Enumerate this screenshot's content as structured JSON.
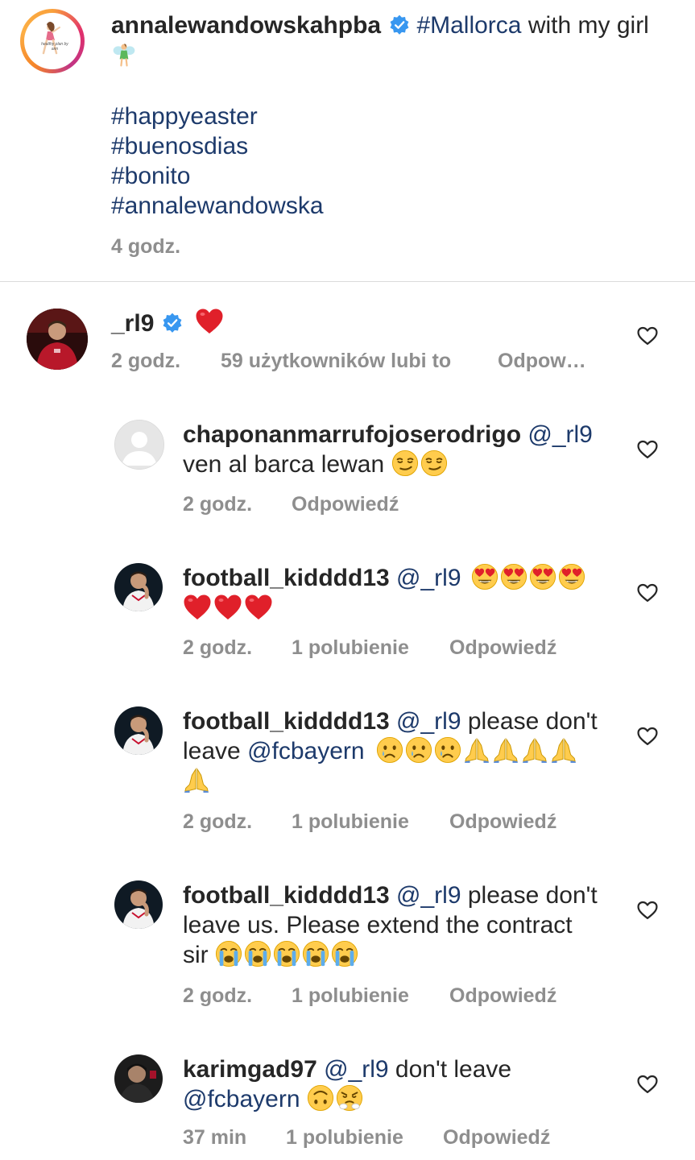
{
  "post": {
    "username": "annalewandowskahpba",
    "caption_tag": "#Mallorca",
    "caption_text": " with my girl",
    "hashtags": [
      "#happyeaster",
      "#buenosdias",
      "#bonito",
      "#annalewandowska"
    ],
    "time": "4 godz.",
    "avatar_text": "healthy plan by ann"
  },
  "comments": [
    {
      "username": "_rl9",
      "verified": true,
      "time": "2 godz.",
      "likes": "59 użytkowników lubi to",
      "reply": "Odpow…"
    },
    {
      "username": "chaponanmarrufojoserodrigo",
      "mention": "@_rl9",
      "line2": "ven al barca lewan ",
      "time": "2 godz.",
      "reply": "Odpowiedź"
    },
    {
      "username": "football_kidddd13",
      "mention": "@_rl9",
      "time": "2 godz.",
      "likes": "1 polubienie",
      "reply": "Odpowiedź"
    },
    {
      "username": "football_kidddd13",
      "mention": "@_rl9",
      "text1": " please don't",
      "text2": "leave ",
      "mention2": "@fcbayern",
      "time": "2 godz.",
      "likes": "1 polubienie",
      "reply": "Odpowiedź"
    },
    {
      "username": "football_kidddd13",
      "mention": "@_rl9",
      "text1": " please don't",
      "text2": "leave us. Please extend the contract",
      "text3": "sir ",
      "time": "2 godz.",
      "likes": "1 polubienie",
      "reply": "Odpowiedź"
    },
    {
      "username": "karimgad97",
      "mention": "@_rl9",
      "text1": " don't leave",
      "mention2": "@fcbayern",
      "time": "37 min",
      "likes": "1 polubienie",
      "reply": "Odpowiedź"
    }
  ],
  "colors": {
    "mention": "#1d3a6b",
    "meta": "#8e8e8e",
    "verified": "#3897f0",
    "heart": "#ed4956"
  },
  "icons": [
    "verified-badge-icon",
    "heart-outline-icon",
    "fairy-emoji",
    "red-heart-emoji",
    "smirk-emoji",
    "heart-eyes-emoji",
    "crying-emoji",
    "praying-hands-emoji",
    "loudly-crying-emoji",
    "upside-down-face-emoji",
    "steam-from-nose-emoji"
  ]
}
